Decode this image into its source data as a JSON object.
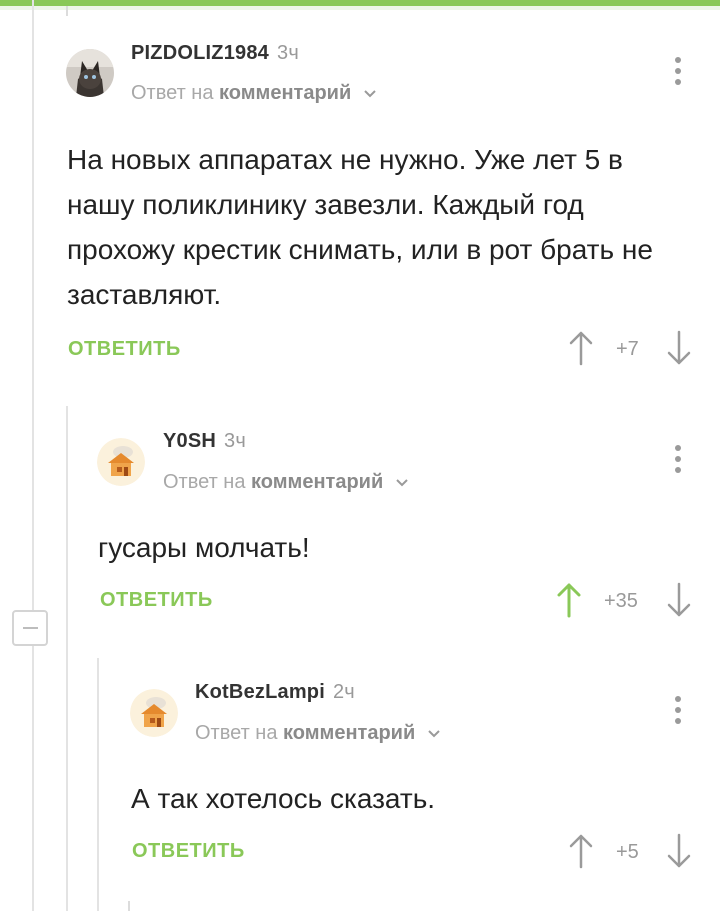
{
  "colors": {
    "accent": "#8ac858",
    "muted": "#999999",
    "text": "#222222"
  },
  "comments": [
    {
      "author": "PIZDOLIZ1984",
      "time": "3ч",
      "reply_prefix": "Ответ на",
      "reply_target": "комментарий",
      "text": "На новых аппаратах не нужно. Уже лет 5 в нашу поликлинику завезли. Каждый год прохожу крестик снимать, или в рот брать не заставляют.",
      "reply_label": "ОТВЕТИТЬ",
      "rating": "+7",
      "upvoted": false,
      "avatar_icon": "cat-avatar-icon"
    },
    {
      "author": "Y0SH",
      "time": "3ч",
      "reply_prefix": "Ответ на",
      "reply_target": "комментарий",
      "text": "гусары молчать!",
      "reply_label": "ОТВЕТИТЬ",
      "rating": "+35",
      "upvoted": true,
      "avatar_icon": "house-avatar-icon"
    },
    {
      "author": "KotBezLampi",
      "time": "2ч",
      "reply_prefix": "Ответ на",
      "reply_target": "комментарий",
      "text": "А так хотелось сказать.",
      "reply_label": "ОТВЕТИТЬ",
      "rating": "+5",
      "upvoted": false,
      "avatar_icon": "house-avatar-icon"
    }
  ]
}
